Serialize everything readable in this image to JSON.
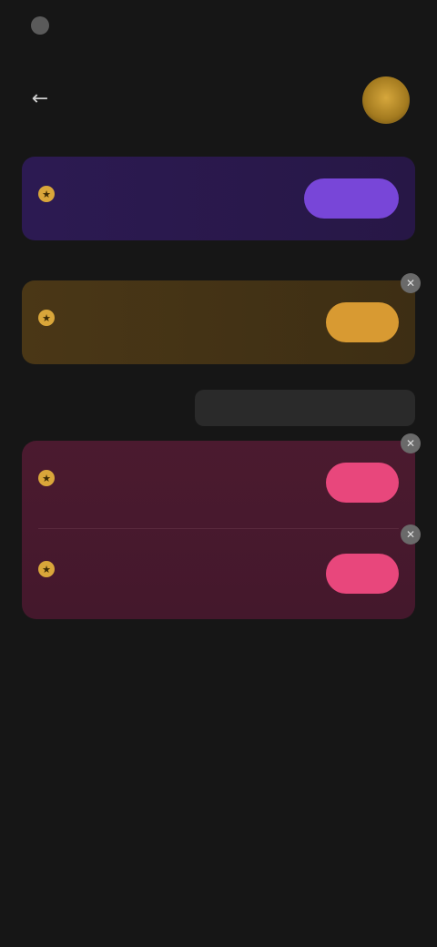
{
  "status": {
    "time": "",
    "right": ""
  },
  "header": {
    "title": "",
    "back_icon": "arrow-left-icon",
    "coin_label": ""
  },
  "section_1_label": "",
  "promo_purple": {
    "title": "",
    "subtitle": "",
    "button": ""
  },
  "section_2_label": "",
  "promo_gold": {
    "title": "",
    "subtitle": "",
    "button": ""
  },
  "tabs": [
    {
      "label": ""
    },
    {
      "label": ""
    }
  ],
  "tasks": [
    {
      "title": "",
      "subtitle": "",
      "button": ""
    },
    {
      "title": "",
      "subtitle": "",
      "button": ""
    }
  ],
  "colors": {
    "background": "#161616",
    "purple_card": "#2c1a52",
    "purple_button": "#7846d8",
    "gold_card": "#4a3716",
    "gold_button": "#d89a32",
    "pink_card": "#4b1a2f",
    "pink_button": "#e8477c"
  }
}
